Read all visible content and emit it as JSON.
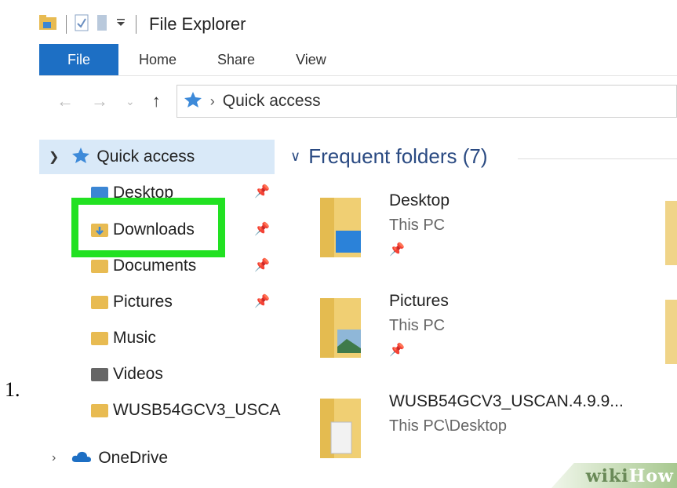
{
  "step": {
    "number": "1."
  },
  "window": {
    "title": "File Explorer"
  },
  "ribbon": {
    "tabs": [
      "File",
      "Home",
      "Share",
      "View"
    ]
  },
  "address": {
    "path": "Quick access"
  },
  "nav": {
    "quick_access": "Quick access",
    "items": [
      "Desktop",
      "Downloads",
      "Documents",
      "Pictures",
      "Music",
      "Videos",
      "WUSB54GCV3_USCA"
    ],
    "onedrive": "OneDrive"
  },
  "content": {
    "group_title": "Frequent folders (7)",
    "tiles": [
      {
        "name": "Desktop",
        "location": "This PC"
      },
      {
        "name": "Pictures",
        "location": "This PC"
      },
      {
        "name": "WUSB54GCV3_USCAN.4.9.9...",
        "location": "This PC\\Desktop"
      }
    ]
  },
  "watermark": {
    "part1": "wiki",
    "part2": "How"
  },
  "colors": {
    "accent": "#1d6fc4",
    "highlight": "#22e122",
    "folder": "#e8bb52",
    "selection": "#d9e9f8"
  }
}
